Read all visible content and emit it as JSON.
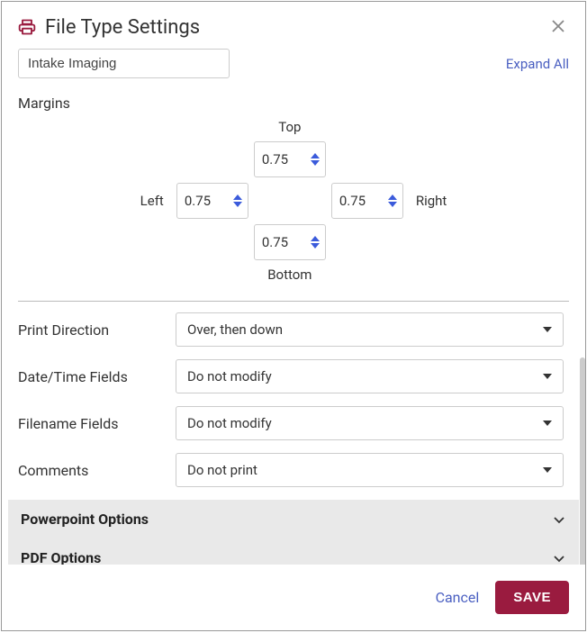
{
  "header": {
    "title": "File Type Settings"
  },
  "name_input": {
    "value": "Intake Imaging"
  },
  "expand_all": "Expand All",
  "margins": {
    "label": "Margins",
    "top_label": "Top",
    "bottom_label": "Bottom",
    "left_label": "Left",
    "right_label": "Right",
    "top": "0.75",
    "bottom": "0.75",
    "left": "0.75",
    "right": "0.75"
  },
  "fields": {
    "print_direction": {
      "label": "Print Direction",
      "value": "Over, then down"
    },
    "datetime": {
      "label": "Date/Time Fields",
      "value": "Do not modify"
    },
    "filename": {
      "label": "Filename Fields",
      "value": "Do not modify"
    },
    "comments": {
      "label": "Comments",
      "value": "Do not print"
    }
  },
  "accordion": {
    "ppt": "Powerpoint Options",
    "pdf": "PDF Options"
  },
  "footer": {
    "cancel": "Cancel",
    "save": "SAVE"
  },
  "colors": {
    "brand": "#9a1b3f",
    "link": "#4a5fc1"
  }
}
